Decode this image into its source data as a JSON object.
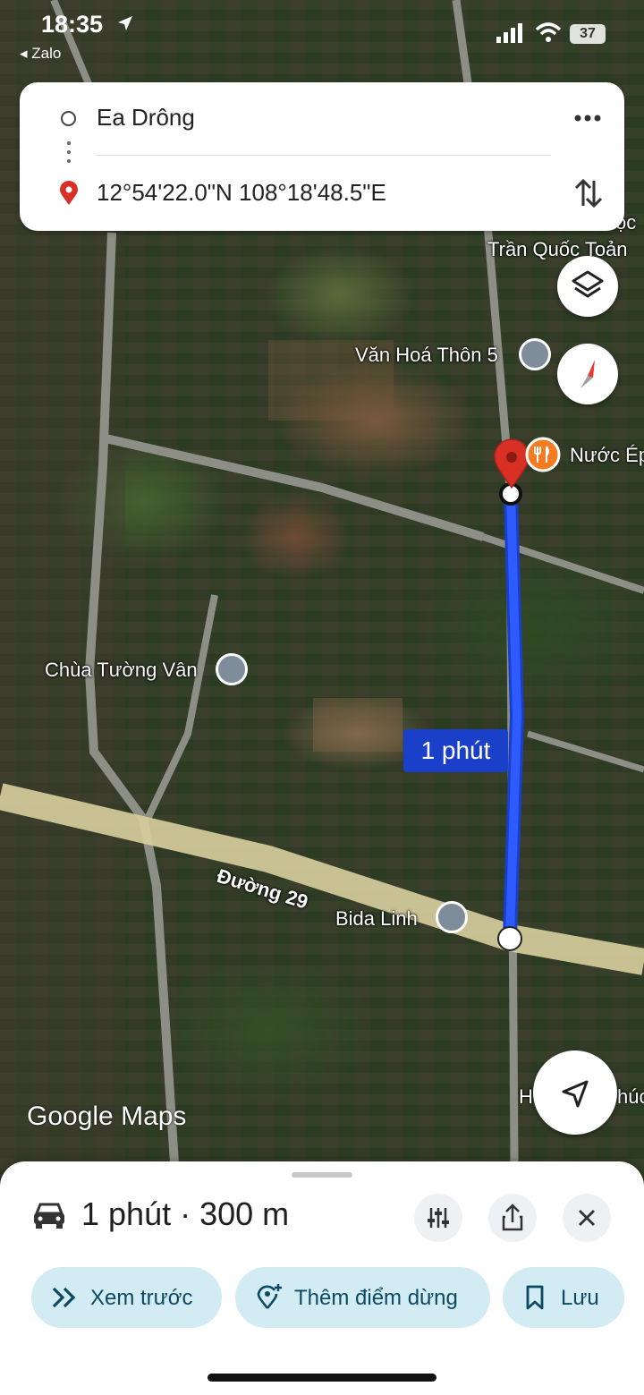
{
  "status_bar": {
    "time": "18:35",
    "back_app": "◂ Zalo",
    "battery": "37"
  },
  "directions": {
    "origin": "Ea Drông",
    "destination": "12°54'22.0\"N 108°18'48.5\"E"
  },
  "map": {
    "labels": {
      "school": "Trần Quốc Toản",
      "school_cut": "ọc",
      "culture_house": "Văn Hoá Thôn 5",
      "restaurant": "Nước Ép",
      "pagoda": "Chùa Tường Vân",
      "road": "Đường 29",
      "billiards": "Bida Linh",
      "bottom_right_a": "H",
      "bottom_right_b": "húc"
    },
    "eta_label": "1 phút",
    "logo": "Google Maps"
  },
  "route_sheet": {
    "summary": "1 phút · 300 m",
    "preview_label": "Xem trước",
    "add_stop_label": "Thêm điểm dừng",
    "save_label": "Lưu"
  },
  "colors": {
    "route": "#1a44e8",
    "pin": "#d93025",
    "chip_bg": "#d3ebf3",
    "chip_text": "#0b4a62"
  }
}
